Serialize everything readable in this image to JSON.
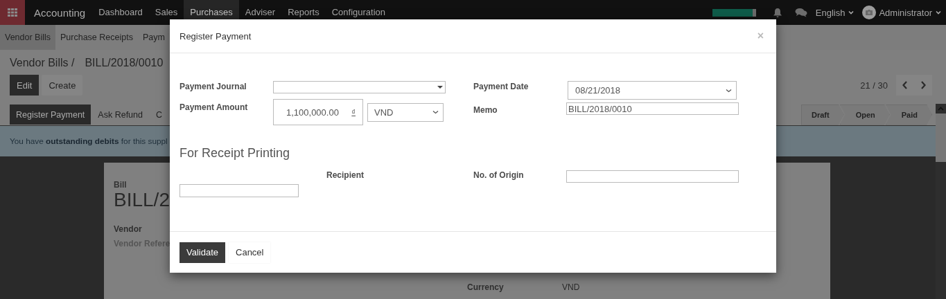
{
  "navbar": {
    "app_title": "Accounting",
    "menu": [
      {
        "label": "Dashboard",
        "selected": false
      },
      {
        "label": "Sales",
        "selected": false
      },
      {
        "label": "Purchases",
        "selected": true
      },
      {
        "label": "Adviser",
        "selected": false
      },
      {
        "label": "Reports",
        "selected": false
      },
      {
        "label": "Configuration",
        "selected": false
      }
    ],
    "progress": {
      "level": 0.93
    },
    "language": "English",
    "user": "Administrator"
  },
  "subnav": [
    {
      "label": "Vendor Bills",
      "selected": true
    },
    {
      "label": "Purchase Receipts",
      "selected": false
    },
    {
      "label": "Paym",
      "selected": false
    }
  ],
  "breadcrumb": {
    "parent": "Vendor Bills /",
    "current": "BILL/2018/0010"
  },
  "actions": [
    {
      "label": "Edit",
      "primary": true
    },
    {
      "label": "Create",
      "primary": false
    }
  ],
  "pager": "21 / 30",
  "workflow_buttons": [
    {
      "label": "Register Payment",
      "primary": true
    },
    {
      "label": "Ask Refund",
      "primary": false
    },
    {
      "label": "C",
      "primary": false
    }
  ],
  "status_steps": [
    "Draft",
    "Open",
    "Paid"
  ],
  "alert": "You have **outstanding debits** for this suppl",
  "sheet": {
    "doc_label": "Bill",
    "doc_number": "BILL/2",
    "vendor_label": "Vendor",
    "vendor_reference_label": "Vendor Refere",
    "currency": {
      "label": "Currency",
      "value": "VND"
    }
  },
  "dialog": {
    "title": "Register Payment",
    "close": "×",
    "payment_journal": {
      "label": "Payment Journal"
    },
    "payment_amount": {
      "label": "Payment Amount",
      "value": "1,100,000.00",
      "symbol": "₫",
      "currency": "VND"
    },
    "payment_date": {
      "label": "Payment Date",
      "value": "08/21/2018"
    },
    "memo": {
      "label": "Memo",
      "value": "BILL/2018/0010"
    },
    "section_title": "For Receipt Printing",
    "recipient": {
      "label": "Recipient"
    },
    "origin_no": {
      "label": "No. of Origin"
    },
    "buttons": [
      {
        "label": "Validate",
        "primary": true
      },
      {
        "label": "Cancel",
        "primary": false
      }
    ]
  }
}
